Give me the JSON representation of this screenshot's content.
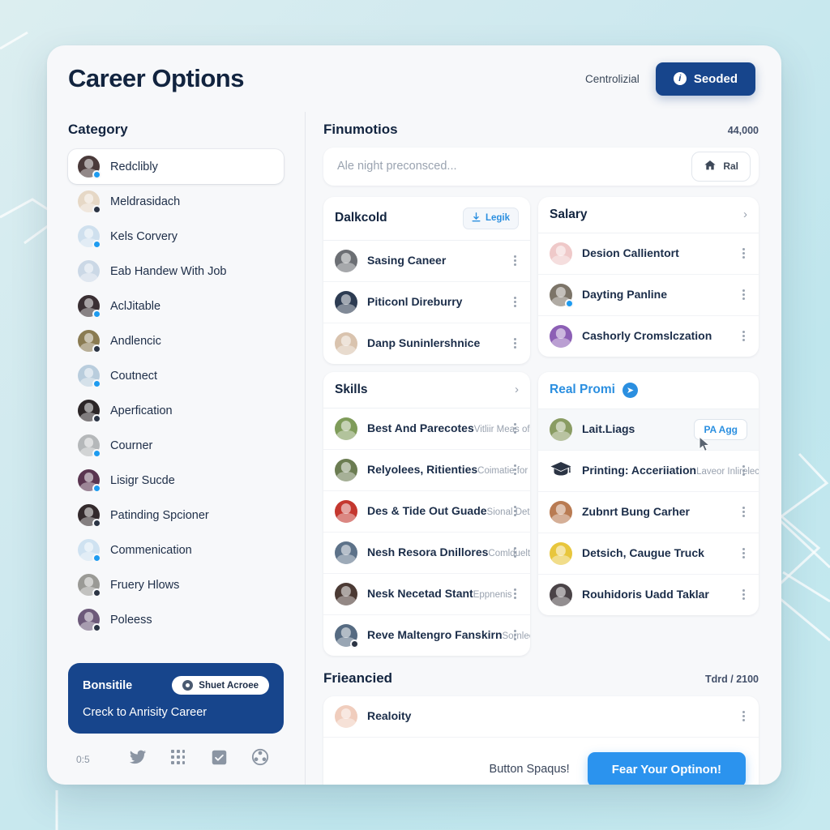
{
  "header": {
    "title": "Career Options",
    "meta": "Centrolizial",
    "primary_button": "Seoded",
    "primary_icon": "info-icon",
    "accent": "#17458c"
  },
  "sidebar": {
    "title": "Category",
    "items": [
      {
        "label": "Redclibly",
        "color": "#4a3a3a",
        "badge": "blue",
        "active": true
      },
      {
        "label": "Meldrasidach",
        "color": "#e6d8c6",
        "badge": "dark",
        "active": false
      },
      {
        "label": "Kels Corvery",
        "color": "#cfe0ee",
        "badge": "blue",
        "active": false
      },
      {
        "label": "Eab Handew With Job",
        "color": "#cbd8e6",
        "badge": "none",
        "active": false
      },
      {
        "label": "AclJitable",
        "color": "#3a2f33",
        "badge": "blue",
        "active": false
      },
      {
        "label": "Andlencic",
        "color": "#8a7b52",
        "badge": "dark",
        "active": false
      },
      {
        "label": "Coutnect",
        "color": "#b9cddd",
        "badge": "blue",
        "active": false
      },
      {
        "label": "Aperfication",
        "color": "#2c2628",
        "badge": "dark",
        "active": false
      },
      {
        "label": "Courner",
        "color": "#b5b8ba",
        "badge": "blue",
        "active": false
      },
      {
        "label": "Lisigr Sucde",
        "color": "#5a3550",
        "badge": "blue",
        "active": false
      },
      {
        "label": "Patinding Spcioner",
        "color": "#332a2c",
        "badge": "dark",
        "active": false
      },
      {
        "label": "Commenication",
        "color": "#cfe2f1",
        "badge": "blue",
        "active": false
      },
      {
        "label": "Fruery Hlows",
        "color": "#9a9a96",
        "badge": "dark",
        "active": false
      },
      {
        "label": "Poleess",
        "color": "#6d5a7a",
        "badge": "dark",
        "active": false
      }
    ],
    "promo": {
      "title": "Bonsitile",
      "pill": "Shuet Acroee",
      "pill_icon": "camera-icon",
      "subtitle": "Creck to Anrisity Career"
    },
    "footer": {
      "counter": "0:5",
      "icons": [
        "bird-icon",
        "grid-icon",
        "checkbox-icon",
        "globe-icon"
      ]
    }
  },
  "main": {
    "section_title": "Finumotios",
    "section_meta": "44,000",
    "search": {
      "placeholder": "Ale night preconsced...",
      "value": "",
      "button_label": "Ral",
      "button_icon": "home-icon"
    },
    "cards": [
      {
        "id": "dalkcold",
        "title": "Dalkcold",
        "action": {
          "type": "ghost",
          "label": "Legik",
          "icon": "download-icon"
        },
        "rows": [
          {
            "name": "Sasing Caneer",
            "sub": "",
            "color": "#6c6f74",
            "badge": "none"
          },
          {
            "name": "Piticonl Direburry",
            "sub": "",
            "color": "#2d3c52",
            "badge": "none"
          },
          {
            "name": "Danp Suninlershnice",
            "sub": "",
            "color": "#d9c3ae",
            "badge": "none"
          }
        ]
      },
      {
        "id": "salary",
        "title": "Salary",
        "action": {
          "type": "chevron",
          "label": "›",
          "icon": "chevron-right-icon"
        },
        "rows": [
          {
            "name": "Desion Callientort",
            "sub": "",
            "color": "#efc9c9",
            "badge": "none"
          },
          {
            "name": "Dayting Panline",
            "sub": "",
            "color": "#7c7468",
            "badge": "blue"
          },
          {
            "name": "Cashorly Cromslczation",
            "sub": "",
            "color": "#8c5fb5",
            "badge": "none"
          }
        ]
      },
      {
        "id": "skills",
        "title": "Skills",
        "action": {
          "type": "chevron",
          "label": "›",
          "icon": "chevron-right-icon"
        },
        "rows": [
          {
            "name": "Best And Parecotes",
            "sub": "Vitliir Meas of Cpmracylionls",
            "color": "#7f9c5a",
            "badge": "none"
          },
          {
            "name": "Relyolees, Ritienties",
            "sub": "Coimatie for INeaoms",
            "color": "#6b7c52",
            "badge": "none"
          },
          {
            "name": "Des & Tide Out Guade",
            "sub": "Sional Dethers",
            "color": "#c4372f",
            "badge": "none"
          },
          {
            "name": "Nesh Resora Dnillores",
            "sub": "Comlduelttios",
            "color": "#5d7289",
            "badge": "none"
          },
          {
            "name": "Nesk Necetad Stant",
            "sub": "Eppnenis",
            "color": "#4b3a34",
            "badge": "none"
          },
          {
            "name": "Reve Maltengro Fanskirn",
            "sub": "Sornleeting",
            "color": "#566b82",
            "badge": "dark"
          }
        ]
      },
      {
        "id": "real-promi",
        "title": "Real Promi",
        "title_color": "#2b8fe0",
        "action": {
          "type": "badge",
          "label": "➤",
          "icon": "send-badge-icon"
        },
        "rows": [
          {
            "name": "Lait.Liags",
            "sub": "",
            "color": "#8a9c63",
            "badge": "none",
            "tag": "PA Agg",
            "highlight": true
          },
          {
            "name": "Printing: Acceriiation",
            "sub": "Laveor Inlirelect",
            "icon": "graduation-cap-icon"
          },
          {
            "name": "Zubnrt Bung Carher",
            "sub": "",
            "color": "#b97b52",
            "badge": "none"
          },
          {
            "name": "Detsich, Caugue Truck",
            "sub": "",
            "color": "#e8c63c",
            "badge": "none"
          },
          {
            "name": "Rouhidoris Uadd Taklar",
            "sub": "",
            "color": "#4a4347",
            "badge": "none"
          }
        ]
      }
    ],
    "bottom": {
      "title": "Frieancied",
      "meta": "Tdrd / 2100",
      "row": {
        "name": "Realoity",
        "color": "#f0cdbd",
        "badge": "none"
      },
      "cta_label": "Button Spaqus!",
      "cta_button": "Fear Your Optinon!",
      "cta_color": "#2b93ee"
    }
  }
}
